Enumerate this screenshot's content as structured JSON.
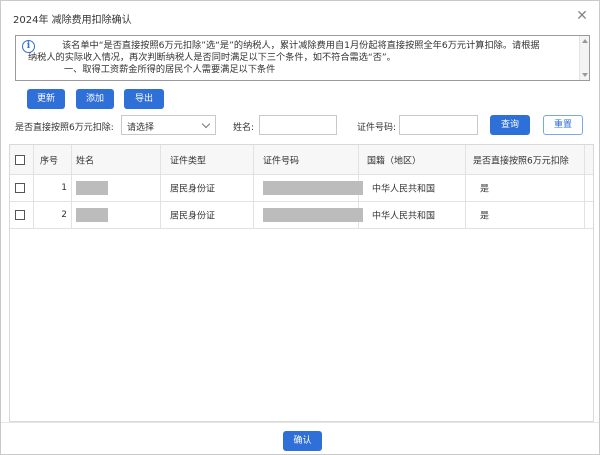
{
  "dialog": {
    "title": "2024年 减除费用扣除确认",
    "notice": {
      "line1": "该名单中“是否直接按照6万元扣除”选“是”的纳税人，累计减除费用自1月份起将直接按照全年6万元计算扣除。请根据",
      "line2": "纳税人的实际收入情况，再次判断纳税人是否同时满足以下三个条件，如不符合需选“否”。",
      "line3": "一、取得工资薪金所得的居民个人需要满足以下条件"
    }
  },
  "toolbar": {
    "refresh_label": "更新",
    "add_label": "添加",
    "export_label": "导出"
  },
  "filters": {
    "direct_label": "是否直接按照6万元扣除:",
    "direct_value": "请选择",
    "name_label": "姓名:",
    "id_label": "证件号码:",
    "query_label": "查询",
    "reset_label": "重置"
  },
  "table": {
    "columns": [
      "序号",
      "姓名",
      "证件类型",
      "证件号码",
      "国籍（地区）",
      "是否直接按照6万元扣除"
    ],
    "rows": [
      {
        "index": "1",
        "id_type": "居民身份证",
        "nationality": "中华人民共和国",
        "direct": "是"
      },
      {
        "index": "2",
        "id_type": "居民身份证",
        "nationality": "中华人民共和国",
        "direct": "是"
      }
    ]
  },
  "footer": {
    "confirm_label": "确认"
  },
  "colors": {
    "accent": "#2f6fd8"
  }
}
